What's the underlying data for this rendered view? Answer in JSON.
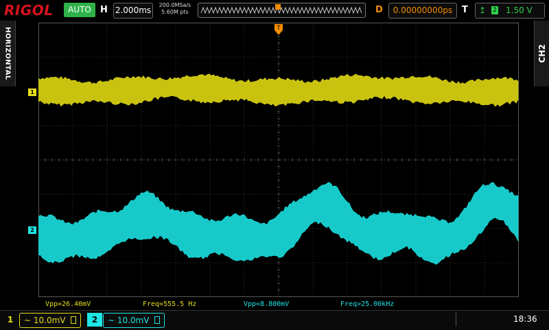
{
  "brand": "RIGOL",
  "header": {
    "trigger_status": "AUTO",
    "horizontal_label": "H",
    "timebase": "2.000ms",
    "sample_rate": "200.0MSa/s",
    "memory_depth": "5.60M pts",
    "delay_label": "D",
    "delay": "0.00000000ps",
    "trigger_label": "T",
    "trigger_source": "2",
    "trigger_level": "1.50 V"
  },
  "side_tabs": {
    "left": "HORIZONTAL",
    "right": "CH2"
  },
  "channel_markers": {
    "ch1": "1",
    "ch2": "2"
  },
  "measurements": {
    "ch1_vpp": "Vpp=26.40mV",
    "ch1_freq": "Freq=555.5 Hz",
    "ch2_vpp": "Vpp=8.800mV",
    "ch2_freq": "Freq>25.00kHz"
  },
  "bottom": {
    "ch1_number": "1",
    "ch1_scale": "10.0mV",
    "ch1_coupling": "~",
    "ch2_number": "2",
    "ch2_scale": "10.0mV",
    "ch2_coupling": "~",
    "time": "18:36"
  },
  "colors": {
    "ch1": "#e6de1c",
    "ch2": "#1fe5e5",
    "trigger": "#f28b00",
    "auto_status": "#2fb24a",
    "brand": "#d8121b"
  },
  "icons": {
    "trigger_edge": "rising-edge-icon",
    "trigger_position": "trigger-position-marker-icon"
  }
}
